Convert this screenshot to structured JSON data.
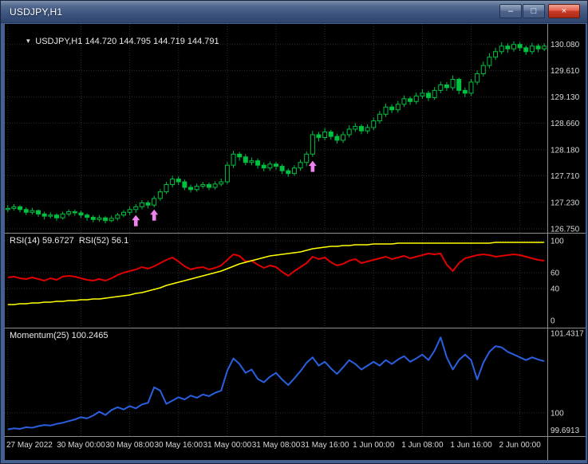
{
  "window": {
    "title": "USDJPY,H1",
    "controls": {
      "minimize_icon": "–",
      "restore_icon": "□",
      "close_icon": "×"
    }
  },
  "chart_ui": {
    "expand_icon": "▼"
  },
  "chart_data": [
    {
      "type": "candlestick",
      "symbol": "USDJPY,H1",
      "ohlc_values": "144.720 144.795 144.719 144.791",
      "ylim": [
        126.68,
        130.45
      ],
      "y_ticks": [
        "130.080",
        "129.610",
        "129.130",
        "128.660",
        "128.180",
        "127.710",
        "127.230",
        "126.750"
      ],
      "x_tick_indices": [
        0,
        12,
        20,
        28,
        36,
        44,
        52,
        60,
        68,
        76,
        84
      ],
      "x_tick_labels": [
        "27 May 2022",
        "30 May 00:00",
        "30 May 08:00",
        "30 May 16:00",
        "31 May 00:00",
        "31 May 08:00",
        "31 May 16:00",
        "1 Jun 00:00",
        "1 Jun 08:00",
        "1 Jun 16:00",
        "2 Jun 00:00"
      ],
      "colors": {
        "candle": "#00c040",
        "bull_fill": "#000000",
        "arrow": "#ee82ee"
      },
      "candles": [
        [
          127.1,
          127.18,
          127.05,
          127.12
        ],
        [
          127.12,
          127.2,
          127.08,
          127.15
        ],
        [
          127.15,
          127.18,
          127.05,
          127.1
        ],
        [
          127.1,
          127.14,
          127.0,
          127.05
        ],
        [
          127.05,
          127.13,
          127.01,
          127.08
        ],
        [
          127.08,
          127.1,
          126.97,
          127.02
        ],
        [
          127.02,
          127.06,
          126.92,
          126.98
        ],
        [
          126.98,
          127.05,
          126.94,
          127.0
        ],
        [
          127.0,
          127.03,
          126.9,
          126.95
        ],
        [
          126.95,
          127.06,
          126.92,
          127.02
        ],
        [
          127.02,
          127.1,
          126.98,
          127.06
        ],
        [
          127.06,
          127.1,
          126.99,
          127.04
        ],
        [
          127.04,
          127.08,
          126.95,
          127.0
        ],
        [
          127.0,
          127.03,
          126.9,
          126.96
        ],
        [
          126.96,
          127.0,
          126.87,
          126.92
        ],
        [
          126.92,
          127.0,
          126.88,
          126.95
        ],
        [
          126.95,
          126.98,
          126.85,
          126.9
        ],
        [
          126.9,
          126.99,
          126.87,
          126.94
        ],
        [
          126.94,
          127.04,
          126.9,
          127.0
        ],
        [
          127.0,
          127.09,
          126.96,
          127.05
        ],
        [
          127.05,
          127.15,
          127.0,
          127.1
        ],
        [
          127.1,
          127.2,
          127.04,
          127.15
        ],
        [
          127.15,
          127.27,
          127.1,
          127.22
        ],
        [
          127.22,
          127.26,
          127.12,
          127.18
        ],
        [
          127.18,
          127.35,
          127.14,
          127.3
        ],
        [
          127.3,
          127.47,
          127.26,
          127.42
        ],
        [
          127.42,
          127.6,
          127.38,
          127.55
        ],
        [
          127.55,
          127.71,
          127.5,
          127.65
        ],
        [
          127.65,
          127.7,
          127.54,
          127.6
        ],
        [
          127.6,
          127.64,
          127.45,
          127.5
        ],
        [
          127.5,
          127.55,
          127.41,
          127.46
        ],
        [
          127.46,
          127.57,
          127.42,
          127.52
        ],
        [
          127.52,
          127.6,
          127.48,
          127.55
        ],
        [
          127.55,
          127.59,
          127.45,
          127.5
        ],
        [
          127.5,
          127.61,
          127.46,
          127.56
        ],
        [
          127.56,
          127.66,
          127.52,
          127.6
        ],
        [
          127.6,
          127.96,
          127.56,
          127.9
        ],
        [
          127.9,
          128.16,
          127.85,
          128.1
        ],
        [
          128.1,
          128.14,
          127.98,
          128.05
        ],
        [
          128.05,
          128.1,
          127.9,
          127.95
        ],
        [
          127.95,
          128.04,
          127.9,
          127.98
        ],
        [
          127.98,
          128.02,
          127.84,
          127.9
        ],
        [
          127.9,
          127.95,
          127.79,
          127.85
        ],
        [
          127.85,
          127.97,
          127.8,
          127.92
        ],
        [
          127.92,
          127.96,
          127.82,
          127.88
        ],
        [
          127.88,
          127.92,
          127.74,
          127.8
        ],
        [
          127.8,
          127.84,
          127.69,
          127.75
        ],
        [
          127.75,
          127.9,
          127.71,
          127.85
        ],
        [
          127.85,
          128.0,
          127.8,
          127.95
        ],
        [
          127.95,
          128.15,
          127.88,
          128.1
        ],
        [
          128.1,
          128.52,
          128.05,
          128.45
        ],
        [
          128.45,
          128.5,
          128.33,
          128.4
        ],
        [
          128.4,
          128.57,
          128.35,
          128.5
        ],
        [
          128.5,
          128.54,
          128.36,
          128.42
        ],
        [
          128.42,
          128.47,
          128.29,
          128.35
        ],
        [
          128.35,
          128.51,
          128.3,
          128.45
        ],
        [
          128.45,
          128.62,
          128.4,
          128.55
        ],
        [
          128.55,
          128.66,
          128.5,
          128.6
        ],
        [
          128.6,
          128.64,
          128.46,
          128.52
        ],
        [
          128.52,
          128.64,
          128.47,
          128.58
        ],
        [
          128.58,
          128.76,
          128.53,
          128.7
        ],
        [
          128.7,
          128.88,
          128.65,
          128.82
        ],
        [
          128.82,
          129.01,
          128.77,
          128.95
        ],
        [
          128.95,
          129.0,
          128.84,
          128.9
        ],
        [
          128.9,
          129.06,
          128.85,
          129.0
        ],
        [
          129.0,
          129.16,
          128.95,
          129.1
        ],
        [
          129.1,
          129.14,
          128.99,
          129.05
        ],
        [
          129.05,
          129.21,
          129.0,
          129.15
        ],
        [
          129.15,
          129.27,
          129.1,
          129.2
        ],
        [
          129.2,
          129.24,
          129.06,
          129.12
        ],
        [
          129.12,
          129.31,
          129.08,
          129.25
        ],
        [
          129.25,
          129.41,
          129.2,
          129.35
        ],
        [
          129.35,
          129.4,
          129.24,
          129.3
        ],
        [
          129.3,
          129.52,
          129.25,
          129.45
        ],
        [
          129.45,
          129.48,
          129.18,
          129.25
        ],
        [
          129.25,
          129.3,
          129.13,
          129.2
        ],
        [
          129.2,
          129.46,
          129.15,
          129.4
        ],
        [
          129.4,
          129.61,
          129.35,
          129.55
        ],
        [
          129.55,
          129.77,
          129.5,
          129.7
        ],
        [
          129.7,
          129.92,
          129.65,
          129.85
        ],
        [
          129.85,
          130.02,
          129.8,
          129.95
        ],
        [
          129.95,
          130.12,
          129.9,
          130.05
        ],
        [
          130.05,
          130.1,
          129.93,
          130.0
        ],
        [
          130.0,
          130.14,
          129.95,
          130.08
        ],
        [
          130.08,
          130.12,
          129.96,
          130.02
        ],
        [
          130.02,
          130.06,
          129.89,
          129.95
        ],
        [
          129.95,
          130.11,
          129.9,
          130.05
        ],
        [
          130.05,
          130.09,
          129.94,
          130.0
        ],
        [
          130.0,
          130.1,
          129.96,
          130.05
        ]
      ],
      "arrows": [
        {
          "index": 21,
          "price": 127.0
        },
        {
          "index": 24,
          "price": 127.1
        },
        {
          "index": 50,
          "price": 127.98
        }
      ]
    },
    {
      "type": "line",
      "label": "RSI(14) 59.6727  RSI(52) 56.1",
      "ylim": [
        -9,
        109
      ],
      "y_ticks": [
        "100",
        "60",
        "40",
        "0"
      ],
      "grid_levels": [
        100,
        60,
        40
      ],
      "series": [
        {
          "name": "RSI(14)",
          "color": "#e00000",
          "width": 2,
          "values": [
            54,
            55,
            53,
            52,
            54,
            52,
            50,
            53,
            51,
            55,
            56,
            55,
            53,
            51,
            50,
            52,
            50,
            53,
            57,
            60,
            62,
            64,
            67,
            65,
            68,
            72,
            76,
            79,
            74,
            68,
            64,
            66,
            67,
            64,
            66,
            69,
            76,
            83,
            81,
            74,
            75,
            70,
            66,
            69,
            67,
            61,
            56,
            62,
            67,
            72,
            80,
            77,
            79,
            73,
            69,
            71,
            75,
            77,
            72,
            74,
            76,
            78,
            80,
            77,
            79,
            81,
            78,
            80,
            82,
            84,
            83,
            84,
            70,
            62,
            72,
            78,
            80,
            82,
            83,
            82,
            80,
            81,
            82,
            83,
            82,
            80,
            78,
            76,
            75
          ]
        },
        {
          "name": "RSI(52)",
          "color": "#ffff00",
          "width": 1.6,
          "values": [
            20,
            20,
            21,
            21,
            22,
            22,
            23,
            23,
            24,
            24,
            25,
            25,
            26,
            26,
            27,
            27,
            28,
            29,
            30,
            31,
            32,
            34,
            35,
            37,
            39,
            41,
            44,
            46,
            48,
            50,
            52,
            54,
            56,
            58,
            60,
            62,
            65,
            68,
            71,
            73,
            75,
            77,
            79,
            81,
            82,
            83,
            84,
            85,
            86,
            88,
            90,
            91,
            92,
            93,
            93,
            94,
            94,
            95,
            95,
            95,
            96,
            96,
            96,
            96,
            97,
            97,
            97,
            97,
            97,
            97,
            97,
            97,
            97,
            97,
            97,
            97,
            97,
            97,
            97,
            97,
            98,
            98,
            98,
            98,
            98,
            98,
            98,
            98,
            98
          ]
        }
      ]
    },
    {
      "type": "line",
      "label": "Momentum(25) 100.2465",
      "ylim": [
        99.58,
        101.52
      ],
      "y_ticks": [
        "101.4317",
        "100",
        "99.6913"
      ],
      "grid_levels": [
        100
      ],
      "series": [
        {
          "name": "Momentum(25)",
          "color": "#2a5fe0",
          "width": 2,
          "values": [
            99.7,
            99.72,
            99.71,
            99.74,
            99.73,
            99.76,
            99.78,
            99.77,
            99.8,
            99.82,
            99.85,
            99.88,
            99.92,
            99.9,
            99.95,
            100.02,
            99.96,
            100.05,
            100.1,
            100.06,
            100.12,
            100.08,
            100.15,
            100.18,
            100.46,
            100.4,
            100.16,
            100.22,
            100.28,
            100.24,
            100.31,
            100.27,
            100.33,
            100.3,
            100.36,
            100.4,
            100.76,
            100.98,
            100.88,
            100.72,
            100.78,
            100.61,
            100.55,
            100.65,
            100.72,
            100.6,
            100.5,
            100.62,
            100.75,
            100.9,
            101.0,
            100.85,
            100.92,
            100.8,
            100.7,
            100.82,
            100.95,
            100.88,
            100.78,
            100.85,
            100.92,
            100.85,
            100.95,
            100.88,
            100.96,
            101.02,
            100.92,
            100.98,
            101.05,
            100.95,
            101.12,
            101.36,
            101.0,
            100.78,
            100.95,
            101.05,
            100.95,
            100.6,
            100.9,
            101.1,
            101.2,
            101.18,
            101.1,
            101.05,
            101.0,
            100.95,
            101.0,
            100.96,
            100.93
          ]
        }
      ]
    }
  ]
}
